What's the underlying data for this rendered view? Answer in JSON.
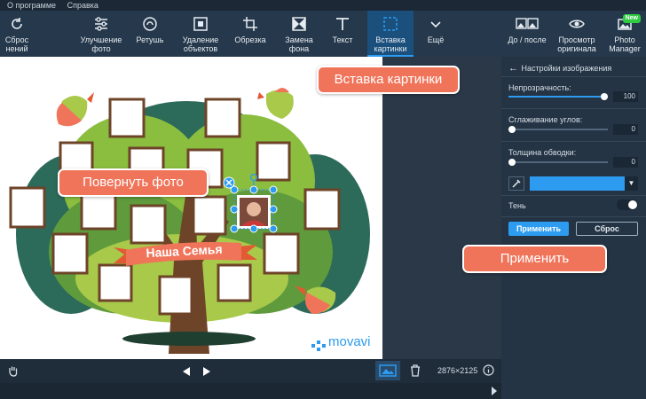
{
  "menu": {
    "about": "О программе",
    "help": "Справка"
  },
  "toolbar": {
    "reset": {
      "line1": "Сброс",
      "line2": "нений"
    },
    "enhance": {
      "line1": "Улучшение",
      "line2": "фото"
    },
    "retouch": "Ретушь",
    "remove_objects": {
      "line1": "Удаление",
      "line2": "объектов"
    },
    "crop": "Обрезка",
    "replace_bg": {
      "line1": "Замена",
      "line2": "фона"
    },
    "text": "Текст",
    "insert_image": {
      "line1": "Вставка",
      "line2": "картинки"
    },
    "more": "Ещё",
    "before_after": "До / после",
    "view_original": {
      "line1": "Просмотр",
      "line2": "оригинала"
    },
    "photo_manager": {
      "line1": "Photo",
      "line2": "Manager"
    },
    "new_badge": "New"
  },
  "image": {
    "banner_text": "Наша Семья",
    "brand": "movavi"
  },
  "panel": {
    "title": "Настройки изображения",
    "opacity": {
      "label": "Непрозрачность:",
      "value": "100",
      "fraction": 1.0
    },
    "corner_smoothing": {
      "label": "Сглаживание углов:",
      "value": "0",
      "fraction": 0.0
    },
    "border_width": {
      "label": "Толщина обводки:",
      "value": "0",
      "fraction": 0.0
    },
    "border_color": "#2d9bf0",
    "shadow": {
      "label": "Тень",
      "on": false
    },
    "apply_button": "Применить",
    "reset_button": "Сброс"
  },
  "bottombar": {
    "dimensions": "2876×2125"
  },
  "callouts": {
    "insert_image": "Вставка картинки",
    "rotate_photo": "Повернуть фото",
    "apply": "Применить"
  },
  "colors": {
    "accent": "#2d9bf0",
    "callout": "#f0745a",
    "toolbar": "#26384b"
  }
}
